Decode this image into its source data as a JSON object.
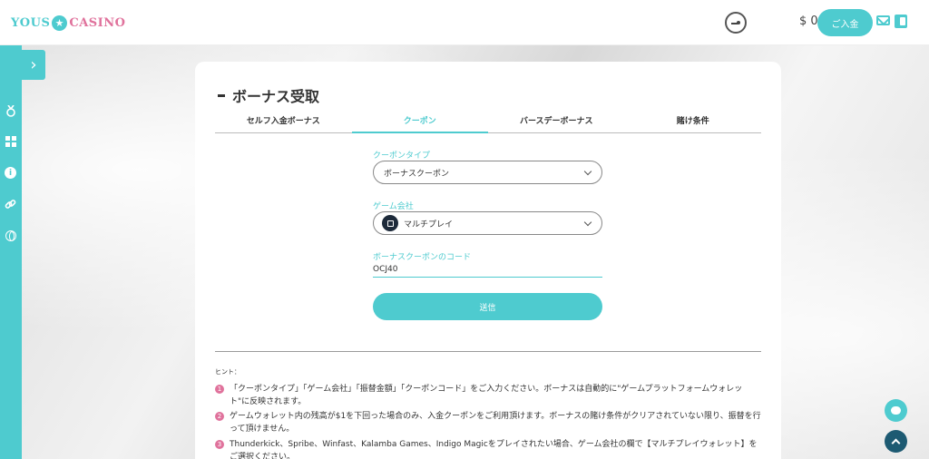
{
  "header": {
    "logo_left": "YOUS",
    "logo_star": "★",
    "logo_right": "CASINO",
    "balance": "$ 0",
    "deposit_label": "ご入金"
  },
  "sidebar": {
    "toggle": "›",
    "icons": [
      "medal-icon",
      "grid-icon",
      "info-icon",
      "link-icon",
      "globe-icon"
    ],
    "info_glyph": "i"
  },
  "page": {
    "title": "ボーナス受取",
    "tabs": [
      {
        "label": "セルフ入金ボーナス",
        "active": false
      },
      {
        "label": "クーポン",
        "active": true
      },
      {
        "label": "バースデーボーナス",
        "active": false
      },
      {
        "label": "賭け条件",
        "active": false
      }
    ]
  },
  "form": {
    "coupon_type_label": "クーポンタイプ",
    "coupon_type_value": "ボーナスクーポン",
    "provider_label": "ゲーム会社",
    "provider_value": "マルチプレイ",
    "code_label": "ボーナスクーポンのコード",
    "code_value": "OCJ40",
    "submit_label": "送信"
  },
  "hints": {
    "title": "ヒント：",
    "items": [
      {
        "num": "1",
        "text": "「クーポンタイプ」「ゲーム会社」「振替金額」「クーポンコード」をご入力ください。ボーナスは自動的に\"ゲームプラットフォームウォレット\"に反映されます。"
      },
      {
        "num": "2",
        "text": "ゲームウォレット内の残高が$1を下回った場合のみ、入金クーポンをご利用頂けます。ボーナスの賭け条件がクリアされていない限り、振替を行って頂けません。"
      },
      {
        "num": "3",
        "text": "Thunderkick、Spribe、Winfast、Kalamba Games、Indigo Magicをプレイされたい場合、ゲーム会社の欄で【マルチプレイウォレット】をご選択ください。"
      }
    ]
  },
  "colors": {
    "accent": "#4ecbcf",
    "pink": "#e0729c",
    "dark": "#1d5a72"
  }
}
